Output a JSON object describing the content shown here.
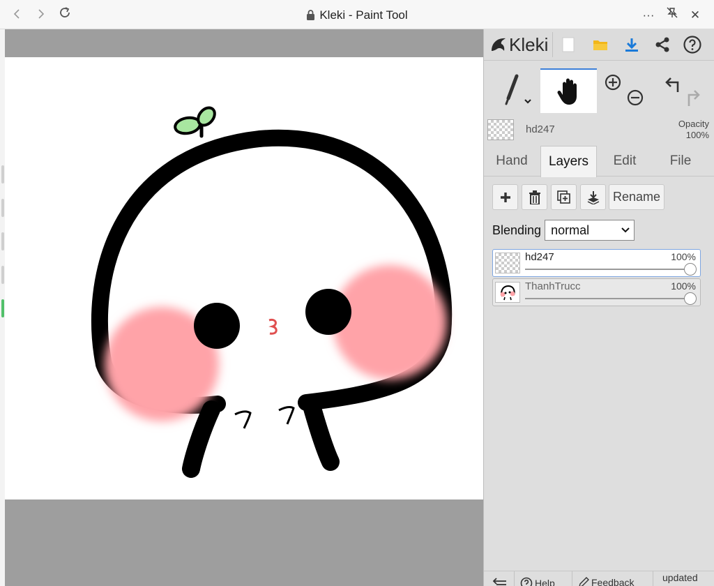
{
  "browser": {
    "title": "Kleki - Paint Tool",
    "back_icon": "chevron-left-icon",
    "forward_icon": "chevron-right-icon",
    "reload_icon": "reload-icon",
    "more_label": "···",
    "close_label": "✕"
  },
  "app": {
    "logo_text": "Kleki",
    "accent_color": "#3c7fd8"
  },
  "layer_info": {
    "name": "hd247",
    "opacity_label": "Opacity",
    "opacity_value": "100%"
  },
  "tabs": [
    "Hand",
    "Layers",
    "Edit",
    "File"
  ],
  "active_tab": "Layers",
  "layers_panel": {
    "rename_label": "Rename",
    "blending_label": "Blending",
    "blending_value": "normal",
    "layers": [
      {
        "name": "hd247",
        "opacity": "100%"
      },
      {
        "name": "ThanhTrucc",
        "opacity": "100%"
      }
    ]
  },
  "footer": {
    "help_label": "Help",
    "feedback_label": "Feedback",
    "updated_label": "updated"
  }
}
